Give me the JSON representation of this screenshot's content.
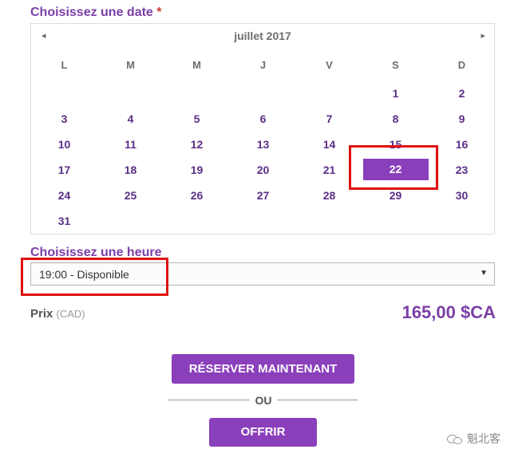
{
  "date_section": {
    "label": "Choisissez une date",
    "required_mark": "*"
  },
  "calendar": {
    "month": "juillet 2017",
    "prev_glyph": "◂",
    "next_glyph": "▸",
    "weekdays": [
      "L",
      "M",
      "M",
      "J",
      "V",
      "S",
      "D"
    ],
    "days": [
      "",
      "",
      "",
      "",
      "",
      "1",
      "2",
      "3",
      "4",
      "5",
      "6",
      "7",
      "8",
      "9",
      "10",
      "11",
      "12",
      "13",
      "14",
      "15",
      "16",
      "17",
      "18",
      "19",
      "20",
      "21",
      "22",
      "23",
      "24",
      "25",
      "26",
      "27",
      "28",
      "29",
      "30",
      "31"
    ],
    "selected_day": "22"
  },
  "time_section": {
    "label": "Choisissez une heure",
    "selected_value": "19:00 - Disponible",
    "dropdown_glyph": "▼"
  },
  "price": {
    "label": "Prix",
    "unit": "(CAD)",
    "value": "165,00 $CA"
  },
  "actions": {
    "reserve_label": "RÉSERVER MAINTENANT",
    "or_text": "OU",
    "offer_label": "OFFRIR"
  },
  "watermark": {
    "text": "魁北客"
  },
  "colors": {
    "accent": "#8a3fbb",
    "label": "#7b3fa6",
    "highlight": "#e01010"
  },
  "icons": [
    "chevron-left-icon",
    "chevron-right-icon",
    "dropdown-arrow-icon",
    "wechat-icon"
  ]
}
